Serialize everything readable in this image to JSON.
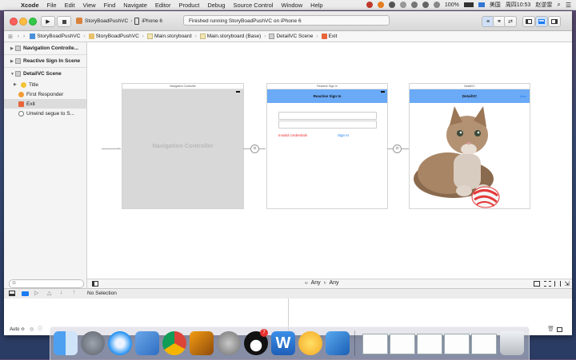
{
  "menubar": {
    "app_name": "Xcode",
    "items": [
      "File",
      "Edit",
      "View",
      "Find",
      "Navigate",
      "Editor",
      "Product",
      "Debug",
      "Source Control",
      "Window",
      "Help"
    ],
    "battery": "100%",
    "input_method": "美国",
    "clock": "周四10:53",
    "user": "赵逆雷"
  },
  "toolbar": {
    "scheme": "StoryBoadPushVC",
    "device": "iPhone 6",
    "activity": "Finished running StoryBoadPushVC on iPhone 6"
  },
  "jumpbar": {
    "crumbs": [
      "StoryBoadPushVC",
      "StoryBoadPushVC",
      "Main.storyboard",
      "Main.storyboard (Base)",
      "DetailVC Scene",
      "Exit"
    ]
  },
  "outline": {
    "scenes": [
      {
        "label": "Navigation Controlle..."
      },
      {
        "label": "Reactive Sign In Scene"
      },
      {
        "label": "DetailVC Scene"
      }
    ],
    "children": [
      {
        "label": "Title"
      },
      {
        "label": "First Responder"
      },
      {
        "label": "Exit"
      },
      {
        "label": "Unwind segue to S..."
      }
    ]
  },
  "canvas": {
    "nav_controller": {
      "title": "Navigation Controller",
      "body": "Navigation Controller"
    },
    "signin": {
      "title": "Reactive Sign In",
      "nav": "Reactive Sign In",
      "error": "Invalid credentials",
      "button": "Sign In"
    },
    "detail": {
      "title": "DetailVC",
      "nav": "DetailVC",
      "nav_right": "Item"
    },
    "size_w": "Any",
    "size_h": "Any"
  },
  "debug": {
    "selection": "No Selection",
    "auto": "Auto ≎"
  },
  "dock": {
    "badge": "7"
  },
  "colors": {
    "nav_bar": "#6aaaf7",
    "accent": "#1b7cf2",
    "error": "#e8322d"
  }
}
